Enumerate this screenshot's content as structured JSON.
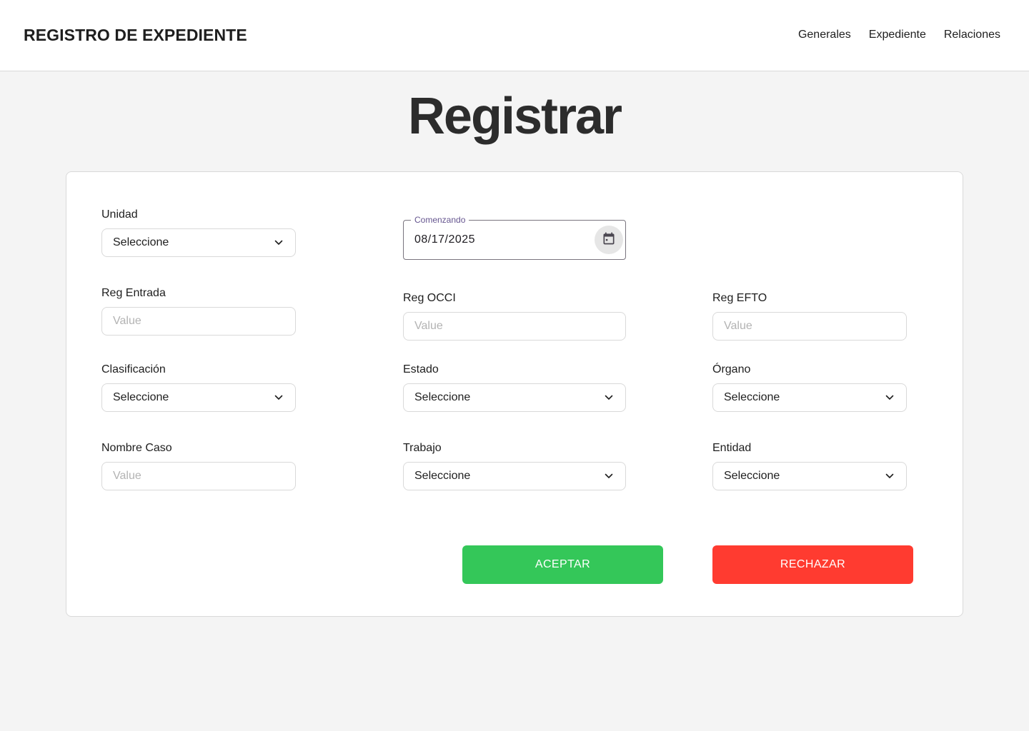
{
  "header": {
    "title": "REGISTRO DE EXPEDIENTE",
    "nav": [
      "Generales",
      "Expediente",
      "Relaciones"
    ]
  },
  "page": {
    "title": "Registrar"
  },
  "form": {
    "unidad": {
      "label": "Unidad",
      "value": "Seleccione"
    },
    "comenzando": {
      "label": "Comenzando",
      "value": "08/17/2025"
    },
    "reg_entrada": {
      "label": "Reg Entrada",
      "placeholder": "Value"
    },
    "reg_occi": {
      "label": "Reg OCCI",
      "placeholder": "Value"
    },
    "reg_efto": {
      "label": "Reg EFTO",
      "placeholder": "Value"
    },
    "clasificacion": {
      "label": "Clasificación",
      "value": "Seleccione"
    },
    "estado": {
      "label": "Estado",
      "value": "Seleccione"
    },
    "organo": {
      "label": "Órgano",
      "value": "Seleccione"
    },
    "nombre_caso": {
      "label": "Nombre Caso",
      "placeholder": "Value"
    },
    "trabajo": {
      "label": "Trabajo",
      "value": "Seleccione"
    },
    "entidad": {
      "label": "Entidad",
      "value": "Seleccione"
    }
  },
  "buttons": {
    "accept": {
      "label": "ACEPTAR",
      "color": "#34c759"
    },
    "reject": {
      "label": "RECHAZAR",
      "color": "#ff3b30"
    }
  },
  "icons": {
    "select": "chevron-down-icon",
    "date": "calendar-icon"
  },
  "colors": {
    "date_legend": "#65558f",
    "background": "#f4f4f4"
  }
}
